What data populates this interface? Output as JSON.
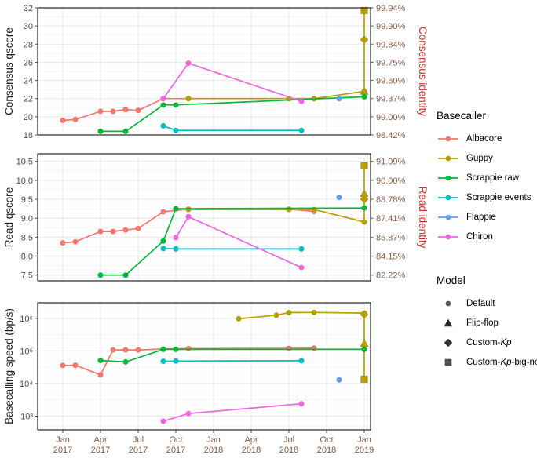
{
  "chart_data": {
    "type": "line",
    "title": "",
    "xlabel": "",
    "x_ticks": [
      {
        "label_top": "Jan",
        "label_bottom": "2017",
        "value": "2017-01"
      },
      {
        "label_top": "Apr",
        "label_bottom": "2017",
        "value": "2017-04"
      },
      {
        "label_top": "Jul",
        "label_bottom": "2017",
        "value": "2017-07"
      },
      {
        "label_top": "Oct",
        "label_bottom": "2017",
        "value": "2017-10"
      },
      {
        "label_top": "Jan",
        "label_bottom": "2018",
        "value": "2018-01"
      },
      {
        "label_top": "Apr",
        "label_bottom": "2018",
        "value": "2018-04"
      },
      {
        "label_top": "Jul",
        "label_bottom": "2018",
        "value": "2018-07"
      },
      {
        "label_top": "Oct",
        "label_bottom": "2018",
        "value": "2018-10"
      },
      {
        "label_top": "Jan",
        "label_bottom": "2019",
        "value": "2019-01"
      }
    ],
    "grid": true,
    "legend_position": "right",
    "panels": [
      {
        "id": "consensus",
        "ylabel": "Consensus qscore",
        "ylabel_right": "Consensus identity",
        "ylim": [
          18,
          32
        ],
        "yticks": [
          18,
          20,
          22,
          24,
          26,
          28,
          30,
          32
        ],
        "ytick_labels": [
          "18",
          "20",
          "22",
          "24",
          "26",
          "28",
          "30",
          "32"
        ],
        "yticks_right": [
          18,
          20,
          22,
          24,
          26,
          28,
          30,
          32
        ],
        "ytick_labels_right": [
          "98.42%",
          "99.00%",
          "99.37%",
          "99.60%",
          "99.75%",
          "99.84%",
          "99.90%",
          "99.94%"
        ],
        "series": [
          {
            "name": "Albacore",
            "color": "#F8766D",
            "points": [
              {
                "x": "2017-01",
                "y": 19.6,
                "model": "Default"
              },
              {
                "x": "2017-02",
                "y": 19.7,
                "model": "Default"
              },
              {
                "x": "2017-04",
                "y": 20.6,
                "model": "Default"
              },
              {
                "x": "2017-05",
                "y": 20.6,
                "model": "Default"
              },
              {
                "x": "2017-06",
                "y": 20.8,
                "model": "Default"
              },
              {
                "x": "2017-07",
                "y": 20.7,
                "model": "Default"
              },
              {
                "x": "2017-09",
                "y": 22.0,
                "model": "Default"
              },
              {
                "x": "2017-11",
                "y": 22.0,
                "model": "Default"
              },
              {
                "x": "2018-07",
                "y": 22.0,
                "model": "Default"
              },
              {
                "x": "2018-09",
                "y": 22.0,
                "model": "Default"
              }
            ]
          },
          {
            "name": "Guppy",
            "color": "#B79F00",
            "points": [
              {
                "x": "2017-11",
                "y": 22.0,
                "model": "Default"
              },
              {
                "x": "2018-07",
                "y": 22.0,
                "model": "Default"
              },
              {
                "x": "2018-09",
                "y": 22.0,
                "model": "Default"
              },
              {
                "x": "2019-01",
                "y": 22.8,
                "model": "Default"
              },
              {
                "x": "2019-01",
                "y": 22.8,
                "model": "Flip-flop"
              },
              {
                "x": "2019-01",
                "y": 28.5,
                "model": "Custom-Kp"
              },
              {
                "x": "2019-01",
                "y": 31.7,
                "model": "Custom-Kp-big-net"
              }
            ]
          },
          {
            "name": "Scrappie raw",
            "color": "#00BA38",
            "points": [
              {
                "x": "2017-04",
                "y": 18.4,
                "model": "Default"
              },
              {
                "x": "2017-06",
                "y": 18.4,
                "model": "Default"
              },
              {
                "x": "2017-09",
                "y": 21.3,
                "model": "Default"
              },
              {
                "x": "2017-10",
                "y": 21.3,
                "model": "Default"
              },
              {
                "x": "2019-01",
                "y": 22.2,
                "model": "Default"
              }
            ]
          },
          {
            "name": "Scrappie events",
            "color": "#00BFC4",
            "points": [
              {
                "x": "2017-09",
                "y": 19.0,
                "model": "Default"
              },
              {
                "x": "2017-10",
                "y": 18.5,
                "model": "Default"
              },
              {
                "x": "2018-08",
                "y": 18.5,
                "model": "Default"
              }
            ]
          },
          {
            "name": "Flappie",
            "color": "#619CFF",
            "points": [
              {
                "x": "2018-11",
                "y": 22.0,
                "model": "Default"
              }
            ]
          },
          {
            "name": "Chiron",
            "color": "#F564E3",
            "points": [
              {
                "x": "2017-09",
                "y": 22.0,
                "model": "Default"
              },
              {
                "x": "2017-11",
                "y": 25.9,
                "model": "Default"
              },
              {
                "x": "2018-08",
                "y": 21.7,
                "model": "Default"
              }
            ]
          }
        ]
      },
      {
        "id": "read",
        "ylabel": "Read qscore",
        "ylabel_right": "Read identity",
        "ylim": [
          7.35,
          10.7
        ],
        "yticks": [
          7.5,
          8.0,
          8.5,
          9.0,
          9.5,
          10.0,
          10.5
        ],
        "ytick_labels": [
          "7.5",
          "8.0",
          "8.5",
          "9.0",
          "9.5",
          "10.0",
          "10.5"
        ],
        "yticks_right": [
          7.5,
          8.0,
          8.5,
          9.0,
          9.5,
          10.0,
          10.5
        ],
        "ytick_labels_right": [
          "82.22%",
          "84.15%",
          "85.87%",
          "87.41%",
          "88.78%",
          "90.00%",
          "91.09%"
        ],
        "series": [
          {
            "name": "Albacore",
            "color": "#F8766D",
            "points": [
              {
                "x": "2017-01",
                "y": 8.35,
                "model": "Default"
              },
              {
                "x": "2017-02",
                "y": 8.38,
                "model": "Default"
              },
              {
                "x": "2017-04",
                "y": 8.65,
                "model": "Default"
              },
              {
                "x": "2017-05",
                "y": 8.65,
                "model": "Default"
              },
              {
                "x": "2017-06",
                "y": 8.69,
                "model": "Default"
              },
              {
                "x": "2017-07",
                "y": 8.73,
                "model": "Default"
              },
              {
                "x": "2017-09",
                "y": 9.17,
                "model": "Default"
              },
              {
                "x": "2017-11",
                "y": 9.24,
                "model": "Default"
              },
              {
                "x": "2018-07",
                "y": 9.24,
                "model": "Default"
              },
              {
                "x": "2018-09",
                "y": 9.18,
                "model": "Default"
              }
            ]
          },
          {
            "name": "Guppy",
            "color": "#B79F00",
            "points": [
              {
                "x": "2017-11",
                "y": 9.23,
                "model": "Default"
              },
              {
                "x": "2018-07",
                "y": 9.23,
                "model": "Default"
              },
              {
                "x": "2018-09",
                "y": 9.23,
                "model": "Default"
              },
              {
                "x": "2019-01",
                "y": 8.9,
                "model": "Default"
              },
              {
                "x": "2019-01",
                "y": 9.5,
                "model": "Custom-Kp"
              },
              {
                "x": "2019-01",
                "y": 9.65,
                "model": "Flip-flop"
              },
              {
                "x": "2019-01",
                "y": 10.38,
                "model": "Custom-Kp-big-net"
              }
            ]
          },
          {
            "name": "Scrappie raw",
            "color": "#00BA38",
            "points": [
              {
                "x": "2017-04",
                "y": 7.5,
                "model": "Default"
              },
              {
                "x": "2017-06",
                "y": 7.5,
                "model": "Default"
              },
              {
                "x": "2017-09",
                "y": 8.4,
                "model": "Default"
              },
              {
                "x": "2017-10",
                "y": 9.25,
                "model": "Default"
              },
              {
                "x": "2019-01",
                "y": 9.27,
                "model": "Default"
              }
            ]
          },
          {
            "name": "Scrappie events",
            "color": "#00BFC4",
            "points": [
              {
                "x": "2017-09",
                "y": 8.2,
                "model": "Default"
              },
              {
                "x": "2017-10",
                "y": 8.19,
                "model": "Default"
              },
              {
                "x": "2018-08",
                "y": 8.19,
                "model": "Default"
              }
            ]
          },
          {
            "name": "Flappie",
            "color": "#619CFF",
            "points": [
              {
                "x": "2018-11",
                "y": 9.55,
                "model": "Default"
              }
            ]
          },
          {
            "name": "Chiron",
            "color": "#F564E3",
            "points": [
              {
                "x": "2017-10",
                "y": 8.49,
                "model": "Default"
              },
              {
                "x": "2017-11",
                "y": 9.04,
                "model": "Default"
              },
              {
                "x": "2018-08",
                "y": 7.7,
                "model": "Default"
              }
            ]
          }
        ]
      },
      {
        "id": "speed",
        "ylabel": "Basecalling speed (bp/s)",
        "ylabel_right": "",
        "ylim_log": [
          380,
          3000000
        ],
        "yticks": [
          1000,
          10000,
          100000,
          1000000
        ],
        "ytick_labels": [
          "10³",
          "10⁴",
          "10⁵",
          "10⁶"
        ],
        "series": [
          {
            "name": "Albacore",
            "color": "#F8766D",
            "points": [
              {
                "x": "2017-01",
                "y": 36000,
                "model": "Default"
              },
              {
                "x": "2017-02",
                "y": 36500,
                "model": "Default"
              },
              {
                "x": "2017-04",
                "y": 18500,
                "model": "Default"
              },
              {
                "x": "2017-05",
                "y": 107000,
                "model": "Default"
              },
              {
                "x": "2017-06",
                "y": 108000,
                "model": "Default"
              },
              {
                "x": "2017-07",
                "y": 107000,
                "model": "Default"
              },
              {
                "x": "2017-09",
                "y": 115000,
                "model": "Default"
              },
              {
                "x": "2017-11",
                "y": 118000,
                "model": "Default"
              },
              {
                "x": "2018-07",
                "y": 120000,
                "model": "Default"
              },
              {
                "x": "2018-09",
                "y": 122000,
                "model": "Default"
              }
            ]
          },
          {
            "name": "Guppy",
            "color": "#B79F00",
            "points": [
              {
                "x": "2018-03",
                "y": 970000,
                "model": "Default"
              },
              {
                "x": "2018-06",
                "y": 1250000,
                "model": "Default"
              },
              {
                "x": "2018-07",
                "y": 1500000,
                "model": "Default"
              },
              {
                "x": "2018-09",
                "y": 1520000,
                "model": "Default"
              },
              {
                "x": "2019-01",
                "y": 1450000,
                "model": "Default"
              },
              {
                "x": "2019-01",
                "y": 1300000,
                "model": "Custom-Kp"
              },
              {
                "x": "2019-01",
                "y": 170000,
                "model": "Flip-flop"
              },
              {
                "x": "2019-01",
                "y": 13500,
                "model": "Custom-Kp-big-net"
              }
            ]
          },
          {
            "name": "Scrappie raw",
            "color": "#00BA38",
            "points": [
              {
                "x": "2017-04",
                "y": 51000,
                "model": "Default"
              },
              {
                "x": "2017-06",
                "y": 46000,
                "model": "Default"
              },
              {
                "x": "2017-09",
                "y": 112000,
                "model": "Default"
              },
              {
                "x": "2017-10",
                "y": 112000,
                "model": "Default"
              },
              {
                "x": "2019-01",
                "y": 112000,
                "model": "Default"
              }
            ]
          },
          {
            "name": "Scrappie events",
            "color": "#00BFC4",
            "points": [
              {
                "x": "2017-09",
                "y": 48000,
                "model": "Default"
              },
              {
                "x": "2017-10",
                "y": 49000,
                "model": "Default"
              },
              {
                "x": "2018-08",
                "y": 50000,
                "model": "Default"
              }
            ]
          },
          {
            "name": "Flappie",
            "color": "#619CFF",
            "points": [
              {
                "x": "2018-11",
                "y": 13000,
                "model": "Default"
              }
            ]
          },
          {
            "name": "Chiron",
            "color": "#F564E3",
            "points": [
              {
                "x": "2017-09",
                "y": 700,
                "model": "Default"
              },
              {
                "x": "2017-11",
                "y": 1200,
                "model": "Default"
              },
              {
                "x": "2018-08",
                "y": 2400,
                "model": "Default"
              }
            ]
          }
        ]
      }
    ]
  },
  "legends": [
    {
      "id": "basecaller",
      "title": "Basecaller",
      "glyph": "line-point",
      "items": [
        {
          "label": "Albacore",
          "color": "#F8766D"
        },
        {
          "label": "Guppy",
          "color": "#B79F00"
        },
        {
          "label": "Scrappie raw",
          "color": "#00BA38"
        },
        {
          "label": "Scrappie events",
          "color": "#00BFC4"
        },
        {
          "label": "Flappie",
          "color": "#619CFF"
        },
        {
          "label": "Chiron",
          "color": "#F564E3"
        }
      ]
    },
    {
      "id": "model",
      "title": "Model",
      "glyph": "shape",
      "items": [
        {
          "label": "Default",
          "label_html": "Default",
          "shape": "circle",
          "color": "#595959"
        },
        {
          "label": "Flip-flop",
          "label_html": "Flip-flop",
          "shape": "triangle",
          "color": "#262626"
        },
        {
          "label": "Custom-Kp",
          "label_html": "Custom-<i class=\"it\">Kp</i>",
          "shape": "diamond",
          "color": "#333333"
        },
        {
          "label": "Custom-Kp-big-net",
          "label_html": "Custom-<i class=\"it\">Kp</i>-big-net",
          "shape": "square",
          "color": "#4d4d4d"
        }
      ]
    }
  ],
  "colors": {
    "albacore": "#F8766D",
    "guppy": "#B79F00",
    "scrappie_raw": "#00BA38",
    "scrappie_events": "#00BFC4",
    "flappie": "#619CFF",
    "chiron": "#F564E3",
    "panel_border": "#262626",
    "grid": "#ebebeb",
    "background": "#ffffff"
  }
}
